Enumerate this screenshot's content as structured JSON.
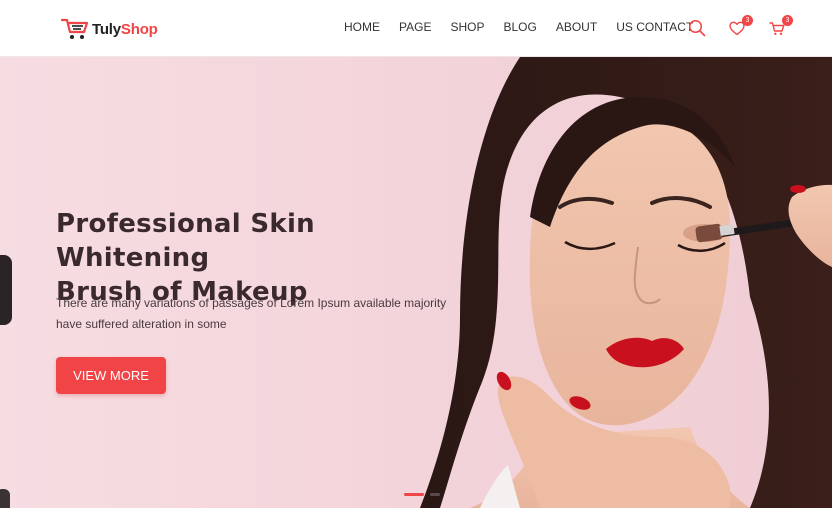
{
  "brand": {
    "name_part1": "Tuly",
    "name_part2": "Shop",
    "accent_color": "#f04446"
  },
  "nav": {
    "items": [
      {
        "label": "HOME"
      },
      {
        "label": "PAGE"
      },
      {
        "label": "SHOP"
      },
      {
        "label": "BLOG"
      },
      {
        "label": "ABOUT"
      },
      {
        "label": "US CONTACT"
      }
    ]
  },
  "tools": {
    "search_icon": "search-icon",
    "wishlist_icon": "heart-icon",
    "wishlist_count": "3",
    "cart_icon": "cart-icon",
    "cart_count": "3"
  },
  "hero": {
    "title_line1": "Professional Skin Whitening",
    "title_line2": "Brush of Makeup",
    "description": "There are many variations of passages of Lorem Ipsum available majority have suffered alteration in some",
    "cta_label": "VIEW MORE",
    "background_color": "#f4d7dd",
    "slides": {
      "total": 2,
      "active": 1
    }
  }
}
